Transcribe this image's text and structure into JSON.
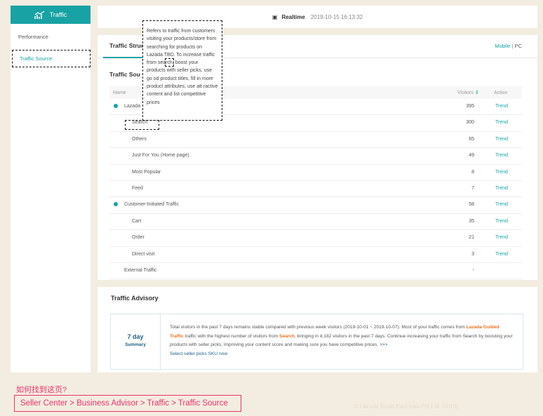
{
  "sidebar": {
    "logo_label": "Traffic",
    "items": [
      {
        "label": "Performance"
      },
      {
        "label": "Traffic Source"
      }
    ]
  },
  "topbar": {
    "realtime_label": "Realtime",
    "timestamp": "2019-10-15 16:13:32"
  },
  "tabs": {
    "active_tab": "Traffic Struc",
    "mobile": "Mobile",
    "separator": "|",
    "pc": "PC"
  },
  "section_title": "Traffic Sou",
  "table": {
    "headers": {
      "name": "Name",
      "visitors": "Visitors",
      "action": "Action"
    },
    "rows": [
      {
        "name": "Lazada",
        "visitors": "395",
        "action": "Trend"
      },
      {
        "name": "Search",
        "visitors": "300",
        "action": "Trend"
      },
      {
        "name": "Others",
        "visitors": "65",
        "action": "Trend"
      },
      {
        "name": "Just For You (Home page)",
        "visitors": "49",
        "action": "Trend"
      },
      {
        "name": "Most Popular",
        "visitors": "8",
        "action": "Trend"
      },
      {
        "name": "Feed",
        "visitors": "7",
        "action": "Trend"
      },
      {
        "name": "Customer-Initiated Traffic",
        "visitors": "58",
        "action": "Trend"
      },
      {
        "name": "Cart",
        "visitors": "35",
        "action": "Trend"
      },
      {
        "name": "Order",
        "visitors": "21",
        "action": "Trend"
      },
      {
        "name": "Direct visit",
        "visitors": "3",
        "action": "Trend"
      },
      {
        "name": "External Traffic",
        "visitors": "-",
        "action": ""
      }
    ]
  },
  "tooltip_text": "Refers to traffic from customers visiting your products/store from searching for products on Lazada TBD. To increase traffic from search, boost your products with seller picks, use go od product titles, fill in more product attributes, use att ractive content and list competitive prices",
  "advisory": {
    "title": "Traffic Advisory",
    "days": "7 day",
    "summary": "Summary",
    "text_1": "Total visitors in the past 7 days remains stable compared with previous week visitors (2019-10-01 ~ 2019-10-07). Most of your traffic comes from ",
    "highlight_1": "Lazada Guided Traffic",
    "text_2": " traffic with the highest number of visitors from ",
    "highlight_2": "Search",
    "text_3": ", bringing in 4,182 visitors in the past 7 days. Continue increasing your traffic from Search by boosting your products with seller picks, improving your content score and making sure you have competitive prices. ",
    "link_arrows": ">>>",
    "link": "Select seller picks SKU now"
  },
  "help": {
    "question": "如何找到这页?",
    "breadcrumb": "Seller Center > Business Advisor > Traffic > Traffic Source"
  },
  "copyright": "© Lazada South East Asia Pte Ltd. [2019]",
  "colors": {
    "accent": "#18a2a4",
    "pink": "#e8336b",
    "orange": "#e8711b"
  }
}
